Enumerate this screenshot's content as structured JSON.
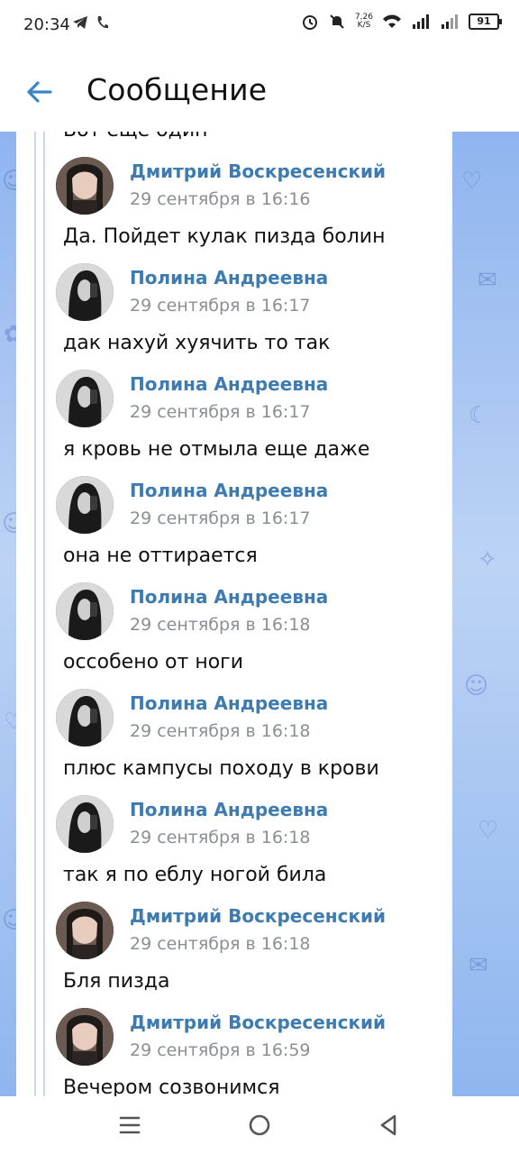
{
  "status_bar": {
    "time": "20:34",
    "net_speed_value": "7,26",
    "net_speed_unit": "K/S",
    "battery": "91"
  },
  "header": {
    "title": "Сообщение"
  },
  "previous_message_text": "Вот еще один",
  "messages": [
    {
      "sender": "Дмитрий Воскресенский",
      "date": "29 сентября в 16:16",
      "text": "Да. Пойдет кулак пизда болин"
    },
    {
      "sender": "Полина Андреевна",
      "date": "29 сентября в 16:17",
      "text": "дак нахуй хуячить то так"
    },
    {
      "sender": "Полина Андреевна",
      "date": "29 сентября в 16:17",
      "text": "я кровь не отмыла еще даже"
    },
    {
      "sender": "Полина Андреевна",
      "date": "29 сентября в 16:17",
      "text": "она не оттирается"
    },
    {
      "sender": "Полина Андреевна",
      "date": "29 сентября в 16:18",
      "text": "оссобено от ноги"
    },
    {
      "sender": "Полина Андреевна",
      "date": "29 сентября в 16:18",
      "text": "плюс кампусы походу в крови"
    },
    {
      "sender": "Полина Андреевна",
      "date": "29 сентября в 16:18",
      "text": "так я по еблу ногой била"
    },
    {
      "sender": "Дмитрий Воскресенский",
      "date": "29 сентября в 16:18",
      "text": "Бля пизда"
    },
    {
      "sender": "Дмитрий Воскресенский",
      "date": "29 сентября в 16:59",
      "text": "Вечером созвонимся"
    }
  ],
  "colors": {
    "accent": "#3d7bb0",
    "back_arrow": "#3a86c8",
    "wallpaper_top": "#8fb4ef",
    "wallpaper_mid": "#bcd3f5"
  },
  "icons": {
    "back": "arrow-left-icon",
    "nav_menu": "menu-lines-icon",
    "nav_home": "home-circle-icon",
    "nav_back": "triangle-back-icon"
  }
}
